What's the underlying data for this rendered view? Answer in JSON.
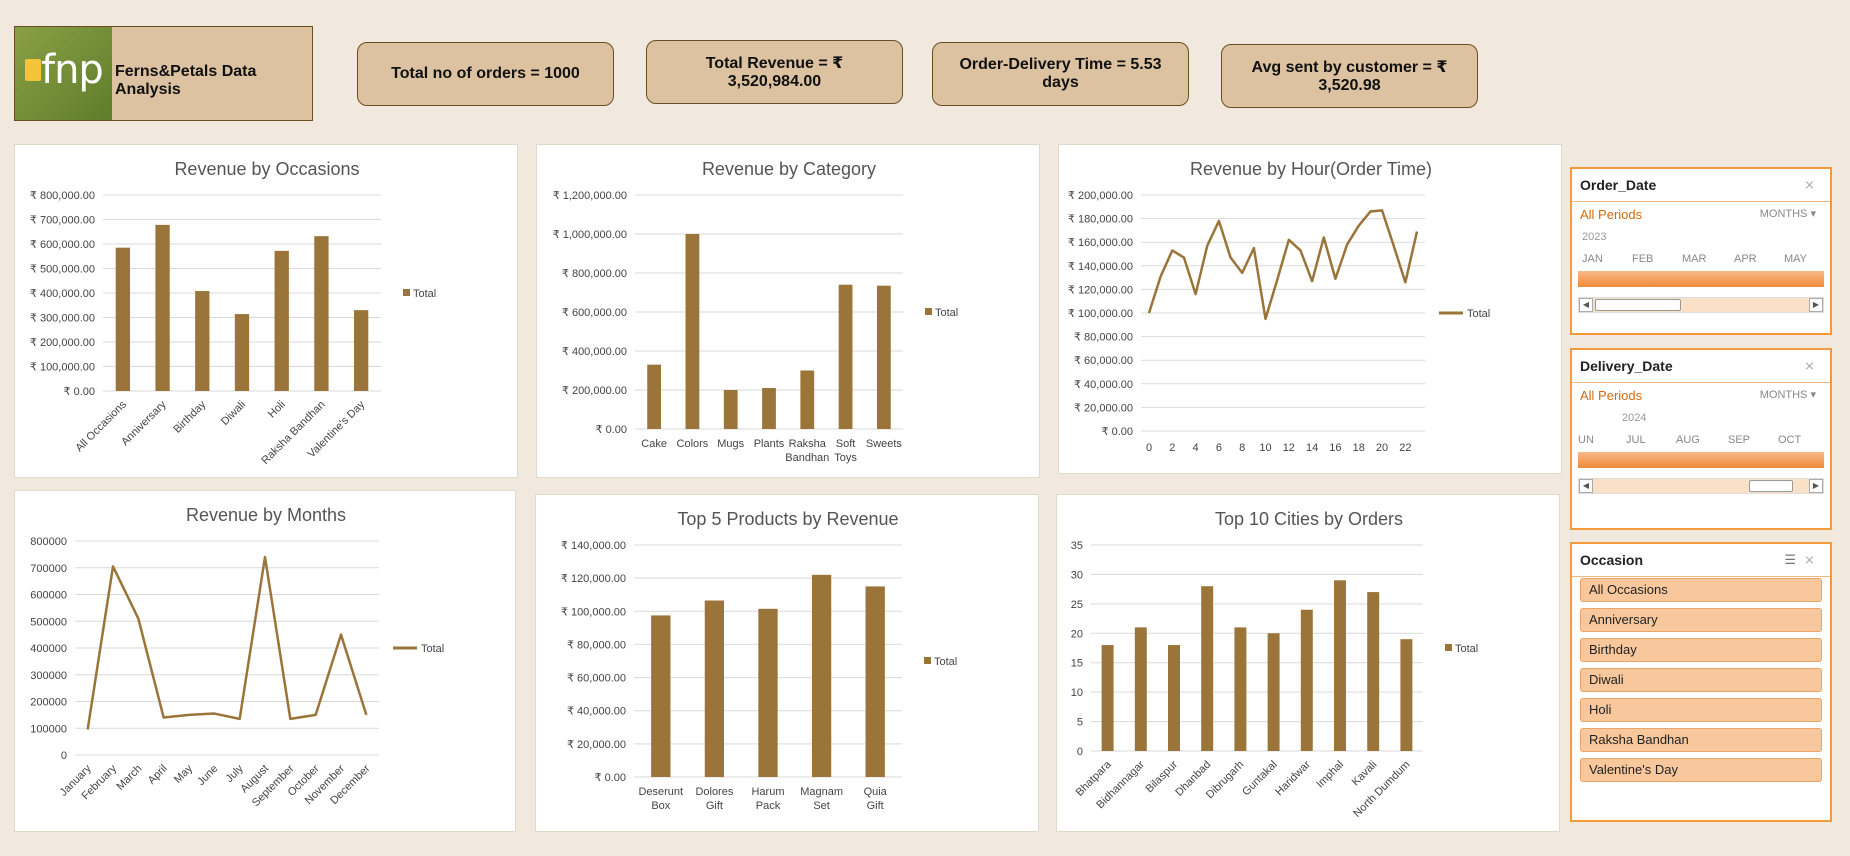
{
  "brand": {
    "logo_text": "fnp",
    "title": "Ferns&Petals Data Analysis"
  },
  "kpis": [
    {
      "label": "Total no of orders = 1000"
    },
    {
      "label": "Total Revenue = ₹ 3,520,984.00"
    },
    {
      "label": "Order-Delivery Time = 5.53 days"
    },
    {
      "label": "Avg sent by customer = ₹ 3,520.98"
    }
  ],
  "colors": {
    "series": "#9a7438",
    "accent": "#f39a3c",
    "background": "#f2e9de",
    "kpi": "#dcc2a1"
  },
  "chart_data": [
    {
      "id": "occasions",
      "type": "bar",
      "title": "Revenue by Occasions",
      "categories": [
        "All Occasions",
        "Anniversary",
        "Birthday",
        "Diwali",
        "Holi",
        "Raksha Bandhan",
        "Valentine's Day"
      ],
      "series": [
        {
          "name": "Total",
          "values": [
            585000,
            678000,
            408000,
            314000,
            572000,
            632000,
            330000
          ]
        }
      ],
      "ylim": [
        0,
        800000
      ],
      "yticks": [
        "₹ 0.00",
        "₹ 100,000.00",
        "₹ 200,000.00",
        "₹ 300,000.00",
        "₹ 400,000.00",
        "₹ 500,000.00",
        "₹ 600,000.00",
        "₹ 700,000.00",
        "₹ 800,000.00"
      ],
      "legend": "right",
      "grid": true
    },
    {
      "id": "category",
      "type": "bar",
      "title": "Revenue by Category",
      "categories": [
        "Cake",
        "Colors",
        "Mugs",
        "Plants",
        "Raksha Bandhan",
        "Soft Toys",
        "Sweets"
      ],
      "series": [
        {
          "name": "Total",
          "values": [
            330000,
            1000000,
            200000,
            210000,
            300000,
            740000,
            735000
          ]
        }
      ],
      "ylim": [
        0,
        1200000
      ],
      "yticks": [
        "₹ 0.00",
        "₹ 200,000.00",
        "₹ 400,000.00",
        "₹ 600,000.00",
        "₹ 800,000.00",
        "₹ 1,000,000.00",
        "₹ 1,200,000.00"
      ],
      "legend": "right",
      "grid": true
    },
    {
      "id": "hour",
      "type": "line",
      "title": "Revenue by Hour(Order Time)",
      "x": [
        0,
        1,
        2,
        3,
        4,
        5,
        6,
        7,
        8,
        9,
        10,
        11,
        12,
        13,
        14,
        15,
        16,
        17,
        18,
        19,
        20,
        21,
        22,
        23
      ],
      "xticks": [
        "0",
        "2",
        "4",
        "6",
        "8",
        "10",
        "12",
        "14",
        "16",
        "18",
        "20",
        "22"
      ],
      "series": [
        {
          "name": "Total",
          "values": [
            100000,
            131000,
            153000,
            147000,
            116000,
            157000,
            178000,
            147000,
            134000,
            155000,
            95000,
            128000,
            162000,
            153000,
            127000,
            164000,
            129000,
            158000,
            174000,
            186000,
            187000,
            157000,
            126000,
            169000
          ]
        }
      ],
      "ylim": [
        0,
        200000
      ],
      "yticks": [
        "₹ 0.00",
        "₹ 20,000.00",
        "₹ 40,000.00",
        "₹ 60,000.00",
        "₹ 80,000.00",
        "₹ 100,000.00",
        "₹ 120,000.00",
        "₹ 140,000.00",
        "₹ 160,000.00",
        "₹ 180,000.00",
        "₹ 200,000.00"
      ],
      "legend": "right",
      "grid": true
    },
    {
      "id": "months",
      "type": "line",
      "title": "Revenue by Months",
      "categories": [
        "January",
        "February",
        "March",
        "April",
        "May",
        "June",
        "July",
        "August",
        "September",
        "October",
        "November",
        "December"
      ],
      "series": [
        {
          "name": "Total",
          "values": [
            95000,
            705000,
            510000,
            140000,
            150000,
            155000,
            135000,
            740000,
            135000,
            150000,
            450000,
            150000
          ]
        }
      ],
      "ylim": [
        0,
        800000
      ],
      "yticks": [
        "0",
        "100000",
        "200000",
        "300000",
        "400000",
        "500000",
        "600000",
        "700000",
        "800000"
      ],
      "legend": "right",
      "grid": true
    },
    {
      "id": "products",
      "type": "bar",
      "title": "Top 5 Products by Revenue",
      "categories": [
        "Deserunt Box",
        "Dolores Gift",
        "Harum Pack",
        "Magnam Set",
        "Quia Gift"
      ],
      "series": [
        {
          "name": "Total",
          "values": [
            97500,
            106500,
            101500,
            122000,
            115000
          ]
        }
      ],
      "ylim": [
        0,
        140000
      ],
      "yticks": [
        "₹ 0.00",
        "₹ 20,000.00",
        "₹ 40,000.00",
        "₹ 60,000.00",
        "₹ 80,000.00",
        "₹ 100,000.00",
        "₹ 120,000.00",
        "₹ 140,000.00"
      ],
      "legend": "right",
      "grid": true
    },
    {
      "id": "cities",
      "type": "bar",
      "title": "Top 10 Cities by Orders",
      "categories": [
        "Bhatpara",
        "Bidhannagar",
        "Bilaspur",
        "Dhanbad",
        "Dibrugarh",
        "Guntakal",
        "Haridwar",
        "Imphal",
        "Kavali",
        "North Dumdum"
      ],
      "series": [
        {
          "name": "Total",
          "values": [
            18,
            21,
            18,
            28,
            21,
            20,
            24,
            29,
            27,
            19
          ]
        }
      ],
      "ylim": [
        0,
        35
      ],
      "yticks": [
        "0",
        "5",
        "10",
        "15",
        "20",
        "25",
        "30",
        "35"
      ],
      "legend": "right",
      "grid": true
    }
  ],
  "slicers": {
    "order_date": {
      "title": "Order_Date",
      "period": "All Periods",
      "mode": "MONTHS",
      "year": "2023",
      "months": [
        "JAN",
        "FEB",
        "MAR",
        "APR",
        "MAY"
      ]
    },
    "delivery_date": {
      "title": "Delivery_Date",
      "period": "All Periods",
      "mode": "MONTHS",
      "year": "2024",
      "months": [
        "UN",
        "JUL",
        "AUG",
        "SEP",
        "OCT"
      ]
    },
    "occasion": {
      "title": "Occasion",
      "items": [
        "All Occasions",
        "Anniversary",
        "Birthday",
        "Diwali",
        "Holi",
        "Raksha Bandhan",
        "Valentine's Day"
      ]
    }
  }
}
